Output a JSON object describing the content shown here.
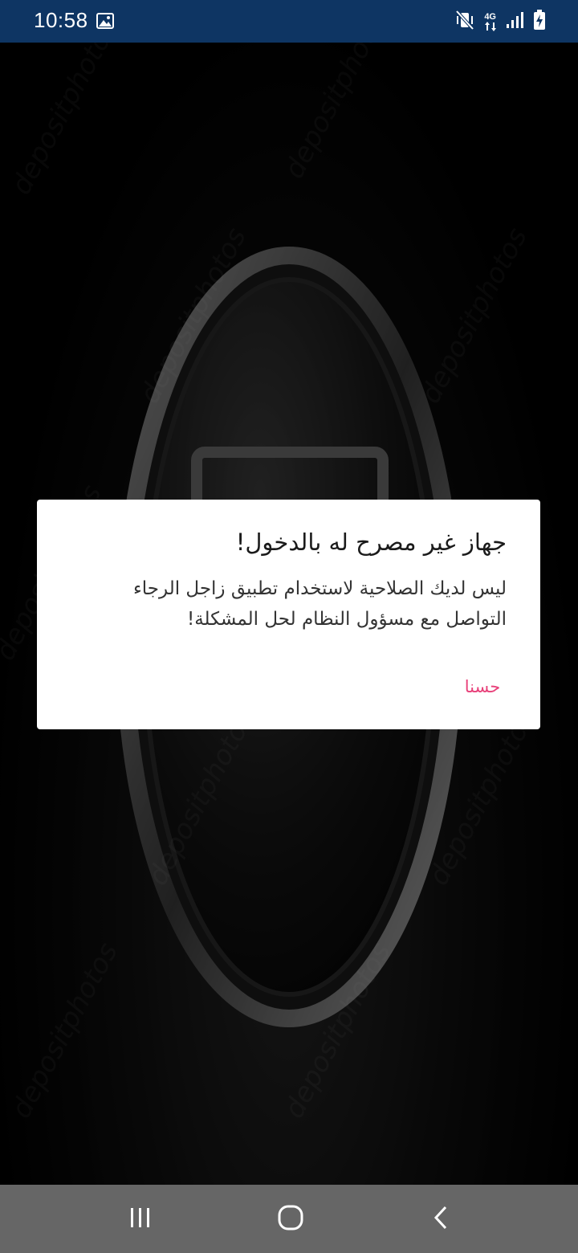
{
  "status_bar": {
    "time": "10:58",
    "network_type": "4G",
    "icons": [
      "image-icon",
      "mute-vibrate-icon",
      "network-4g-icon",
      "signal-icon",
      "battery-charging-icon"
    ]
  },
  "background": {
    "watermark_text": "depositphotos"
  },
  "dialog": {
    "title": "جهاز غير مصرح له بالدخول!",
    "message": "ليس لديك الصلاحية لاستخدام تطبيق زاجل الرجاء التواصل مع مسؤول النظام لحل المشكلة!",
    "ok_label": "حسنا",
    "accent_color": "#e8417a"
  },
  "nav_bar": {
    "buttons": [
      "recent-apps-icon",
      "home-icon",
      "back-icon"
    ]
  }
}
